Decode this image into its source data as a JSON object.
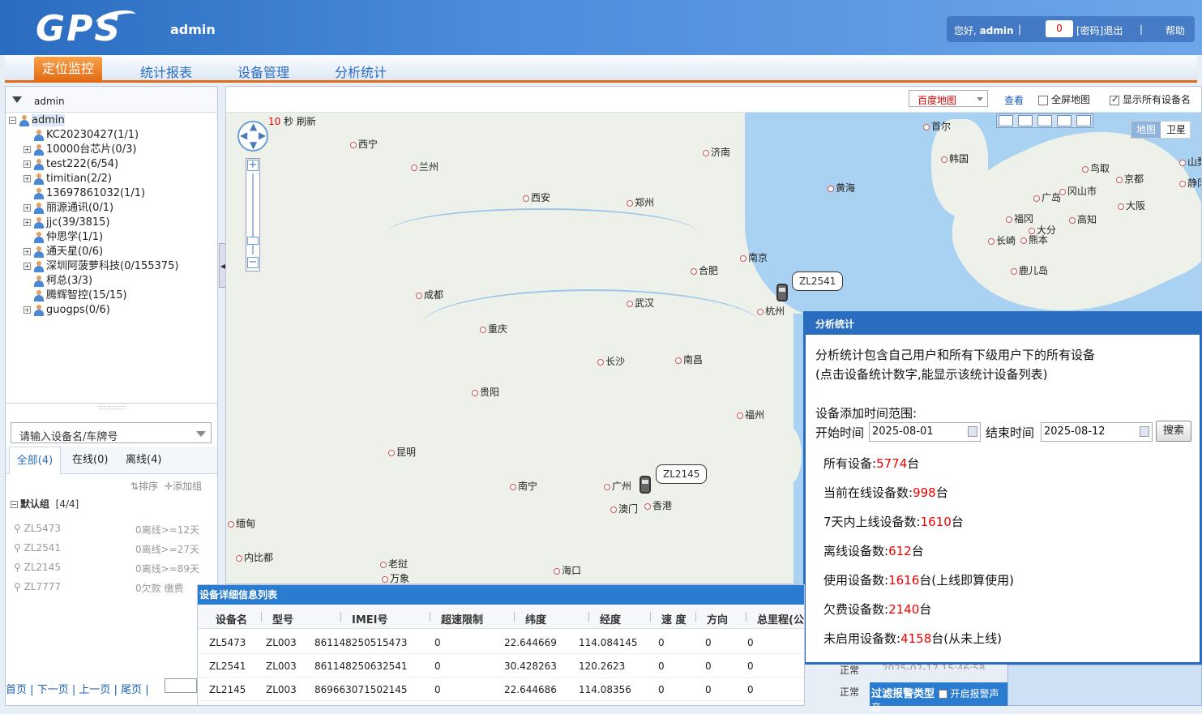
{
  "header": {
    "logo": "GPS",
    "user": "admin",
    "greeting": "您好,",
    "greeting_user": "admin",
    "sep1": "|",
    "message_count": "0",
    "password_logout": "[密码]退出",
    "sep2": "|",
    "help": "帮助"
  },
  "nav": {
    "items": [
      "定位监控",
      "统计报表",
      "设备管理",
      "分析统计"
    ]
  },
  "tree": {
    "head_label": "admin",
    "root": "admin",
    "nodes": [
      {
        "label": "KC20230427(1/1)",
        "expandable": false
      },
      {
        "label": "10000台芯片(0/3)",
        "expandable": true
      },
      {
        "label": "test222(6/54)",
        "expandable": true
      },
      {
        "label": "timitian(2/2)",
        "expandable": true
      },
      {
        "label": "13697861032(1/1)",
        "expandable": false
      },
      {
        "label": "丽源通讯(0/1)",
        "expandable": true
      },
      {
        "label": "jjc(39/3815)",
        "expandable": true
      },
      {
        "label": "仲思学(1/1)",
        "expandable": false
      },
      {
        "label": "通天星(0/6)",
        "expandable": true
      },
      {
        "label": "深圳阿菠萝科技(0/155375)",
        "expandable": true
      },
      {
        "label": "柯总(3/3)",
        "expandable": false
      },
      {
        "label": "腾辉智控(15/15)",
        "expandable": false
      },
      {
        "label": "guogps(0/6)",
        "expandable": true
      }
    ]
  },
  "device_panel": {
    "search_placeholder": "请输入设备名/车牌号",
    "tabs": [
      "全部(4)",
      "在线(0)",
      "离线(4)"
    ],
    "sort_label": "排序",
    "add_group_label": "添加组",
    "group_name": "默认组",
    "group_count": "[4/4]",
    "devices": [
      {
        "name": "ZL5473",
        "status": "0离线>=12天"
      },
      {
        "name": "ZL2541",
        "status": "0离线>=27天"
      },
      {
        "name": "ZL2145",
        "status": "0离线>=89天"
      },
      {
        "name": "ZL7777",
        "status": "0欠款 缴费"
      }
    ],
    "pager": [
      "首页",
      "下一页",
      "上一页",
      "尾页"
    ],
    "pager_sep": "|"
  },
  "map": {
    "map_type": "百度地图",
    "view_label": "查看",
    "fullscreen_label": "全屏地图",
    "fullscreen_checked": false,
    "show_all_label": "显示所有设备名",
    "show_all_checked": true,
    "refresh_seconds": "10",
    "refresh_suffix": "秒 刷新",
    "view_map": "地图",
    "view_satellite": "卫星",
    "sea_color": "#a9d2f2",
    "cities": [
      {
        "name": "西宁"
      },
      {
        "name": "兰州"
      },
      {
        "name": "济南"
      },
      {
        "name": "西安"
      },
      {
        "name": "郑州"
      },
      {
        "name": "首尔"
      },
      {
        "name": "韩国"
      },
      {
        "name": "黄海"
      },
      {
        "name": "南京"
      },
      {
        "name": "合肥"
      },
      {
        "name": "成都"
      },
      {
        "name": "武汉"
      },
      {
        "name": "杭州"
      },
      {
        "name": "重庆"
      },
      {
        "name": "长沙"
      },
      {
        "name": "南昌"
      },
      {
        "name": "贵阳"
      },
      {
        "name": "福州"
      },
      {
        "name": "昆明"
      },
      {
        "name": "南宁"
      },
      {
        "name": "广州"
      },
      {
        "name": "澳门"
      },
      {
        "name": "香港"
      },
      {
        "name": "缅甸"
      },
      {
        "name": "内比都"
      },
      {
        "name": "老挝"
      },
      {
        "name": "万象"
      },
      {
        "name": "海口"
      },
      {
        "name": "鸟取"
      },
      {
        "name": "京都"
      },
      {
        "name": "冈山市"
      },
      {
        "name": "广岛"
      },
      {
        "name": "大阪"
      },
      {
        "name": "福冈"
      },
      {
        "name": "高知"
      },
      {
        "name": "大分"
      },
      {
        "name": "长崎"
      },
      {
        "name": "熊本"
      },
      {
        "name": "鹿儿岛"
      },
      {
        "name": "山梨"
      },
      {
        "name": "静冈"
      }
    ],
    "vehicles": [
      {
        "name": "ZL2541"
      },
      {
        "name": "ZL2145"
      }
    ]
  },
  "stats": {
    "title": "分析统计",
    "desc1": "分析统计包含自己用户和所有下级用户下的所有设备",
    "desc2": "(点击设备统计数字,能显示该统计设备列表)",
    "range_label": "设备添加时间范围:",
    "start_label": "开始时间",
    "start_date": "2025-08-01",
    "end_label": "结束时间",
    "end_date": "2025-08-12",
    "search_label": "搜索",
    "unit": "台",
    "items": [
      {
        "label": "所有设备:",
        "value": "5774",
        "suffix": ""
      },
      {
        "label": "当前在线设备数:",
        "value": "998",
        "suffix": ""
      },
      {
        "label": "7天内上线设备数:",
        "value": "1610",
        "suffix": ""
      },
      {
        "label": "离线设备数:",
        "value": "612",
        "suffix": ""
      },
      {
        "label": "使用设备数:",
        "value": "1616",
        "suffix": "(上线即算使用)"
      },
      {
        "label": "欠费设备数:",
        "value": "2140",
        "suffix": ""
      },
      {
        "label": "未启用设备数:",
        "value": "4158",
        "suffix": "(从未上线)"
      }
    ]
  },
  "device_list": {
    "title": "设备详细信息列表",
    "columns": [
      "设备名",
      "型号",
      "IMEI号",
      "超速限制",
      "纬度",
      "经度",
      "速 度",
      "方向",
      "总里程(公"
    ],
    "rows": [
      [
        "ZL5473",
        "ZL003",
        "861148250515473",
        "0",
        "22.644669",
        "114.084145",
        "0",
        "0",
        "0"
      ],
      [
        "ZL2541",
        "ZL003",
        "861148250632541",
        "0",
        "30.428263",
        "120.2623",
        "0",
        "0",
        "0"
      ],
      [
        "ZL2145",
        "ZL003",
        "869663071502145",
        "0",
        "22.644686",
        "114.08356",
        "0",
        "0",
        "0"
      ]
    ],
    "status_peek": "正常",
    "time_peek": "2025-07-17 15:46:58",
    "status_normal": "正常"
  },
  "alarm": {
    "filter_label": "过滤报警类型",
    "sound_label": "开启报警声音",
    "sound_checked": false
  },
  "colors": {
    "brand_blue": "#2a6cc0",
    "accent_orange": "#e36b16",
    "value_red": "#e00"
  }
}
